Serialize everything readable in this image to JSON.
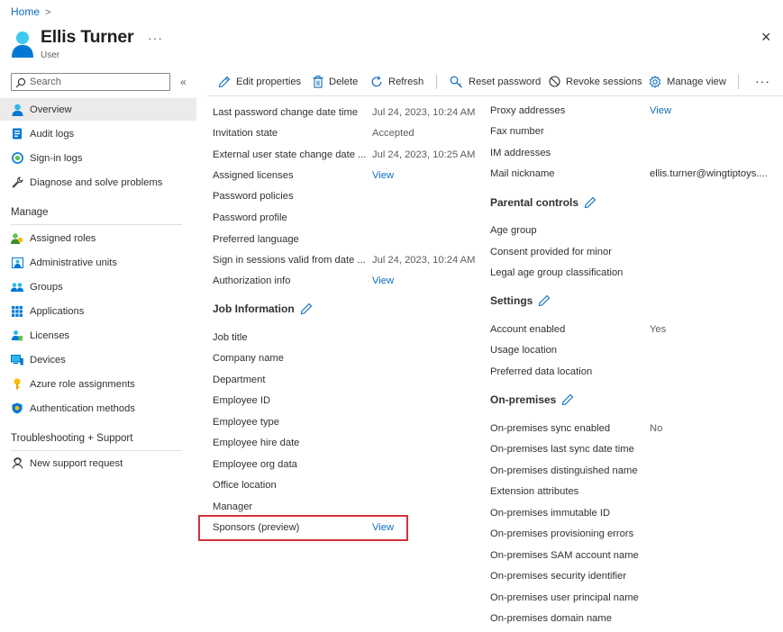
{
  "breadcrumb": {
    "home": "Home",
    "separator": ">"
  },
  "header": {
    "title": "Ellis Turner",
    "subtitle": "User",
    "more": "···",
    "close": "×"
  },
  "sidebar": {
    "search_placeholder": "Search",
    "collapse": "«",
    "items": [
      {
        "label": "Overview",
        "icon": "user-icon"
      },
      {
        "label": "Audit logs",
        "icon": "audit-log-icon"
      },
      {
        "label": "Sign-in logs",
        "icon": "sign-in-icon"
      },
      {
        "label": "Diagnose and solve problems",
        "icon": "wrench-icon"
      }
    ],
    "manage_title": "Manage",
    "manage_items": [
      {
        "label": "Assigned roles",
        "icon": "roles-icon"
      },
      {
        "label": "Administrative units",
        "icon": "admin-units-icon"
      },
      {
        "label": "Groups",
        "icon": "groups-icon"
      },
      {
        "label": "Applications",
        "icon": "applications-icon"
      },
      {
        "label": "Licenses",
        "icon": "licenses-icon"
      },
      {
        "label": "Devices",
        "icon": "devices-icon"
      },
      {
        "label": "Azure role assignments",
        "icon": "key-icon"
      },
      {
        "label": "Authentication methods",
        "icon": "shield-icon"
      }
    ],
    "support_title": "Troubleshooting + Support",
    "support_items": [
      {
        "label": "New support request",
        "icon": "support-person-icon"
      }
    ]
  },
  "toolbar": {
    "edit": "Edit properties",
    "delete": "Delete",
    "refresh": "Refresh",
    "reset_password": "Reset password",
    "revoke_sessions": "Revoke sessions",
    "manage_view": "Manage view",
    "more": "···"
  },
  "left_props": {
    "rows": [
      {
        "label": "Last password change date time",
        "value": "Jul 24, 2023, 10:24 AM"
      },
      {
        "label": "Invitation state",
        "value": "Accepted"
      },
      {
        "label": "External user state change date ...",
        "value": "Jul 24, 2023, 10:25 AM"
      },
      {
        "label": "Assigned licenses",
        "value": "View"
      },
      {
        "label": "Password policies",
        "value": ""
      },
      {
        "label": "Password profile",
        "value": ""
      },
      {
        "label": "Preferred language",
        "value": ""
      },
      {
        "label": "Sign in sessions valid from date ...",
        "value": "Jul 24, 2023, 10:24 AM"
      },
      {
        "label": "Authorization info",
        "value": "View"
      }
    ],
    "job_title": "Job Information",
    "job_rows": [
      {
        "label": "Job title",
        "value": ""
      },
      {
        "label": "Company name",
        "value": ""
      },
      {
        "label": "Department",
        "value": ""
      },
      {
        "label": "Employee ID",
        "value": ""
      },
      {
        "label": "Employee type",
        "value": ""
      },
      {
        "label": "Employee hire date",
        "value": ""
      },
      {
        "label": "Employee org data",
        "value": ""
      },
      {
        "label": "Office location",
        "value": ""
      },
      {
        "label": "Manager",
        "value": ""
      },
      {
        "label": "Sponsors (preview)",
        "value": "View"
      }
    ]
  },
  "right_props": {
    "rows": [
      {
        "label": "Proxy addresses",
        "value": "View"
      },
      {
        "label": "Fax number",
        "value": ""
      },
      {
        "label": "IM addresses",
        "value": ""
      },
      {
        "label": "Mail nickname",
        "value": "ellis.turner@wingtiptoys...."
      }
    ],
    "parental_title": "Parental controls",
    "parental_rows": [
      {
        "label": "Age group",
        "value": ""
      },
      {
        "label": "Consent provided for minor",
        "value": ""
      },
      {
        "label": "Legal age group classification",
        "value": ""
      }
    ],
    "settings_title": "Settings",
    "settings_rows": [
      {
        "label": "Account enabled",
        "value": "Yes"
      },
      {
        "label": "Usage location",
        "value": ""
      },
      {
        "label": "Preferred data location",
        "value": ""
      }
    ],
    "onprem_title": "On-premises",
    "onprem_rows": [
      {
        "label": "On-premises sync enabled",
        "value": "No"
      },
      {
        "label": "On-premises last sync date time",
        "value": ""
      },
      {
        "label": "On-premises distinguished name",
        "value": ""
      },
      {
        "label": "Extension attributes",
        "value": ""
      },
      {
        "label": "On-premises immutable ID",
        "value": ""
      },
      {
        "label": "On-premises provisioning errors",
        "value": ""
      },
      {
        "label": "On-premises SAM account name",
        "value": ""
      },
      {
        "label": "On-premises security identifier",
        "value": ""
      },
      {
        "label": "On-premises user principal name",
        "value": ""
      },
      {
        "label": "On-premises domain name",
        "value": ""
      }
    ]
  },
  "colors": {
    "accent": "#0f6cbd",
    "highlight": "#d13438",
    "selected": "#ecebea"
  }
}
